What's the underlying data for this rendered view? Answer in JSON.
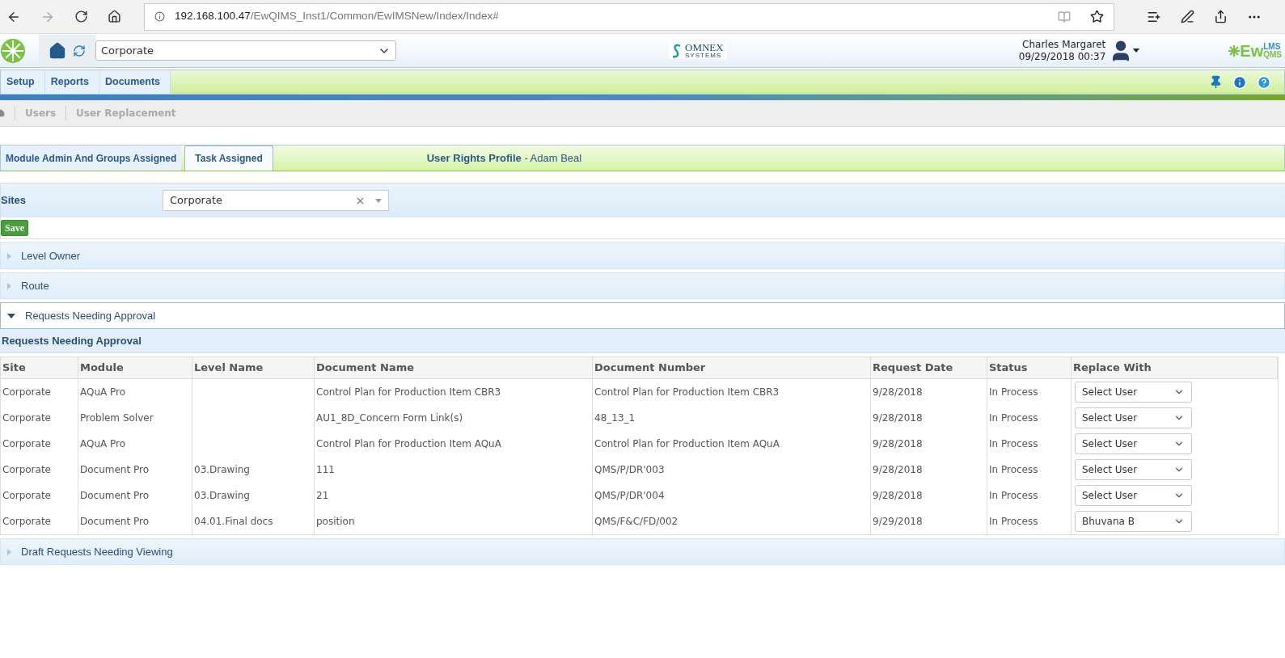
{
  "browser": {
    "url_host": "192.168.100.47",
    "url_path": "/EwQIMS_Inst1/Common/EwIMSNew/Index/Index#"
  },
  "header": {
    "site_select": "Corporate",
    "omnex_name": "OMNEX",
    "omnex_sub": "SYSTEMS",
    "user_name": "Charles Margaret",
    "datetime": "09/29/2018 00:37",
    "brand_main": "Ew",
    "brand_top": "LMS",
    "brand_bottom": "QMS"
  },
  "menu": [
    {
      "label": "Setup"
    },
    {
      "label": "Reports"
    },
    {
      "label": "Documents"
    }
  ],
  "breadcrumb": [
    "Users",
    "User Replacement"
  ],
  "tabs": [
    {
      "label": "Module Admin And Groups Assigned",
      "selected": false
    },
    {
      "label": "Task Assigned",
      "selected": true
    }
  ],
  "profile": {
    "label": "User Rights Profile",
    "name": "- Adam Beal"
  },
  "sites": {
    "label": "Sites",
    "value": "Corporate"
  },
  "save_button": "Save",
  "sections": [
    {
      "title": "Level Owner",
      "expanded": false
    },
    {
      "title": "Route",
      "expanded": false
    },
    {
      "title": "Requests Needing Approval",
      "expanded": true,
      "subtitle": "Requests Needing Approval",
      "table": {
        "columns": [
          "Site",
          "Module",
          "Level Name",
          "Document Name",
          "Document Number",
          "Request Date",
          "Status",
          "Replace With"
        ],
        "rows": [
          [
            "Corporate",
            "AQuA Pro",
            "",
            "Control Plan for Production Item CBR3",
            "Control Plan for Production Item CBR3",
            "9/28/2018",
            "In Process",
            "Select User"
          ],
          [
            "Corporate",
            "Problem Solver",
            "",
            "AU1_8D_Concern Form Link(s)",
            "48_13_1",
            "9/28/2018",
            "In Process",
            "Select User"
          ],
          [
            "Corporate",
            "AQuA Pro",
            "",
            "Control Plan for Production Item AQuA",
            "Control Plan for Production Item AQuA",
            "9/28/2018",
            "In Process",
            "Select User"
          ],
          [
            "Corporate",
            "Document Pro",
            "03.Drawing",
            "111",
            "QMS/P/DR'003",
            "9/28/2018",
            "In Process",
            "Select User"
          ],
          [
            "Corporate",
            "Document Pro",
            "03.Drawing",
            "21",
            "QMS/P/DR'004",
            "9/28/2018",
            "In Process",
            "Select User"
          ],
          [
            "Corporate",
            "Document Pro",
            "04.01.Final docs",
            "position",
            "QMS/F&C/FD/002",
            "9/29/2018",
            "In Process",
            "Bhuvana B"
          ]
        ]
      }
    },
    {
      "title": "Draft Requests Needing Viewing",
      "expanded": false
    }
  ]
}
